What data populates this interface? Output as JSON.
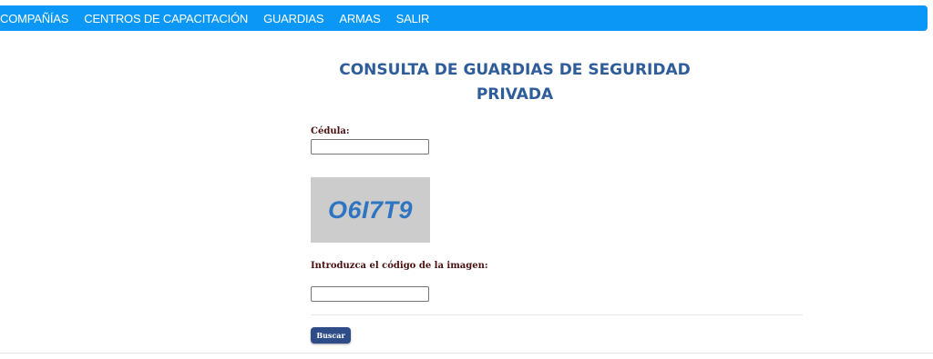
{
  "nav": {
    "items": [
      "COMPAÑÍAS",
      "CENTROS DE CAPACITACIÓN",
      "GUARDIAS",
      "ARMAS",
      "SALIR"
    ]
  },
  "page": {
    "title_line1": "CONSULTA DE GUARDIAS DE SEGURIDAD",
    "title_line2": "PRIVADA"
  },
  "form": {
    "cedula_label": "Cédula:",
    "cedula_value": "",
    "captcha_text": "O6I7T9",
    "code_label": "Introduzca el código de la imagen:",
    "code_value": "",
    "search_button": "Buscar"
  },
  "colors": {
    "navbar": "#0a97f5",
    "title": "#2e5d9a",
    "label": "#4a1010",
    "button": "#2e4d88",
    "captcha_bg": "#cccccc",
    "captcha_text": "#2f74c0"
  }
}
